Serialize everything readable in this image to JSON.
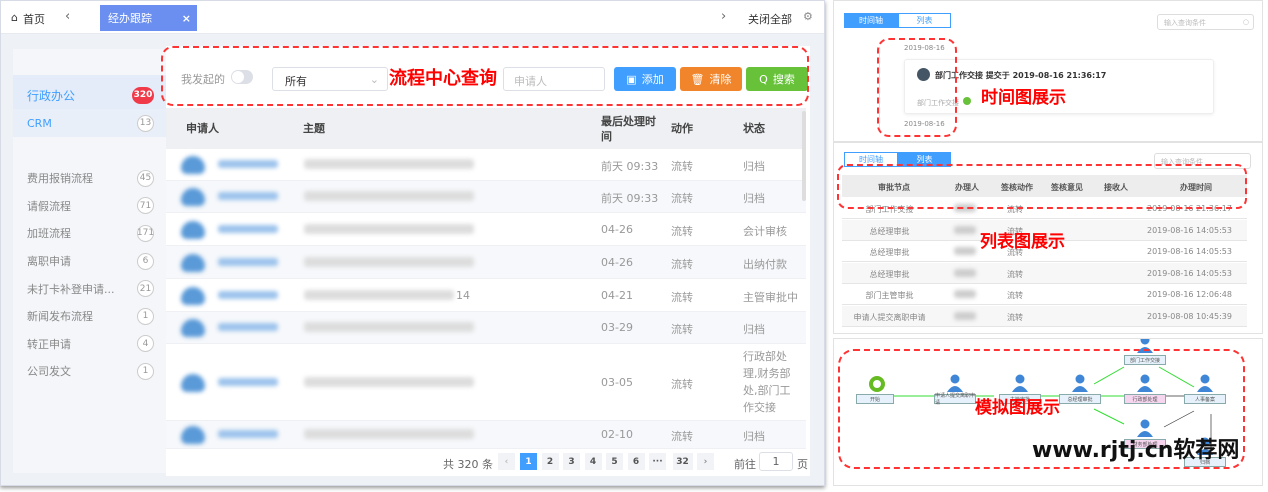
{
  "tabs": {
    "home": "首页",
    "active": "经办跟踪",
    "close_all": "关闭全部"
  },
  "sidebar": {
    "items": [
      {
        "label": "行政办公",
        "count": "320"
      },
      {
        "label": "CRM",
        "count": "13"
      },
      {
        "label": "费用报销流程",
        "count": "45"
      },
      {
        "label": "请假流程",
        "count": "71"
      },
      {
        "label": "加班流程",
        "count": "171"
      },
      {
        "label": "离职申请",
        "count": "6"
      },
      {
        "label": "未打卡补登申请...",
        "count": "21"
      },
      {
        "label": "新闻发布流程",
        "count": "1"
      },
      {
        "label": "转正申请",
        "count": "4"
      },
      {
        "label": "公司发文",
        "count": "1"
      }
    ]
  },
  "filter": {
    "mine_label": "我发起的",
    "select_value": "所有",
    "applicant_placeholder": "申请人",
    "add": "添加",
    "clear": "清除",
    "search": "搜索"
  },
  "table": {
    "headers": [
      "申请人",
      "主题",
      "最后处理时间",
      "动作",
      "状态"
    ],
    "rows": [
      {
        "subject_suffix": "",
        "time": "前天 09:33",
        "action": "流转",
        "status": "归档"
      },
      {
        "subject_suffix": "",
        "time": "前天 09:33",
        "action": "流转",
        "status": "归档"
      },
      {
        "subject_suffix": "",
        "time": "04-26",
        "action": "流转",
        "status": "会计审核"
      },
      {
        "subject_suffix": "",
        "time": "04-26",
        "action": "流转",
        "status": "出纳付款"
      },
      {
        "subject_suffix": "14",
        "time": "04-21",
        "action": "流转",
        "status": "主管审批中"
      },
      {
        "subject_suffix": "",
        "time": "03-29",
        "action": "流转",
        "status": "归档"
      },
      {
        "subject_suffix": "",
        "time": "03-05",
        "action": "流转",
        "status": "行政部处理,财务部处,部门工作交接"
      },
      {
        "subject_suffix": "",
        "time": "02-10",
        "action": "流转",
        "status": "归档"
      }
    ]
  },
  "pagination": {
    "total": "共 320 条",
    "pages": [
      "1",
      "2",
      "3",
      "4",
      "5",
      "6",
      "···",
      "32"
    ],
    "current": "1",
    "goto": "前往",
    "goto_value": "1",
    "page_unit": "页"
  },
  "annotations": {
    "query": "流程中心查询",
    "timeline": "时间图展示",
    "list": "列表图展示",
    "diagram": "模拟图展示",
    "watermark": "www.rjtj.cn软荐网"
  },
  "timeline_panel": {
    "tabs": [
      "时间轴",
      "列表"
    ],
    "search_placeholder": "输入查询条件",
    "date1": "2019-08-16",
    "entry_title": "部门工作交接 提交于 2019-08-16 21:36:17",
    "entry_sub": "部门工作交接",
    "date2": "2019-08-16"
  },
  "list_panel": {
    "tabs": [
      "时间轴",
      "列表"
    ],
    "search_placeholder": "输入查询条件",
    "headers": [
      "审批节点",
      "办理人",
      "签核动作",
      "签核意见",
      "接收人",
      "办理时间"
    ],
    "rows": [
      {
        "node": "部门工作交接",
        "action": "流转",
        "time": "2019-08-16 21:36:17"
      },
      {
        "node": "总经理审批",
        "action": "流转",
        "time": "2019-08-16 14:05:53"
      },
      {
        "node": "总经理审批",
        "action": "流转",
        "time": "2019-08-16 14:05:53"
      },
      {
        "node": "总经理审批",
        "action": "流转",
        "time": "2019-08-16 14:05:53"
      },
      {
        "node": "部门主管审批",
        "action": "流转",
        "time": "2019-08-16 12:06:48"
      },
      {
        "node": "申请人提交离职申请",
        "action": "流转",
        "time": "2019-08-08 10:45:39"
      }
    ]
  },
  "diagram": {
    "nodes": [
      "开始",
      "申请人提交离职申请",
      "主管审批",
      "总经理审批",
      "部门工作交接",
      "行政部处理",
      "财务部处理",
      "人事备案",
      "归档"
    ]
  },
  "colors": {
    "primary": "#409eff",
    "add": "#409eff",
    "clear": "#f0852b",
    "search": "#67c23a",
    "badge": "#f03a4a",
    "annotation": "#ff0000"
  }
}
